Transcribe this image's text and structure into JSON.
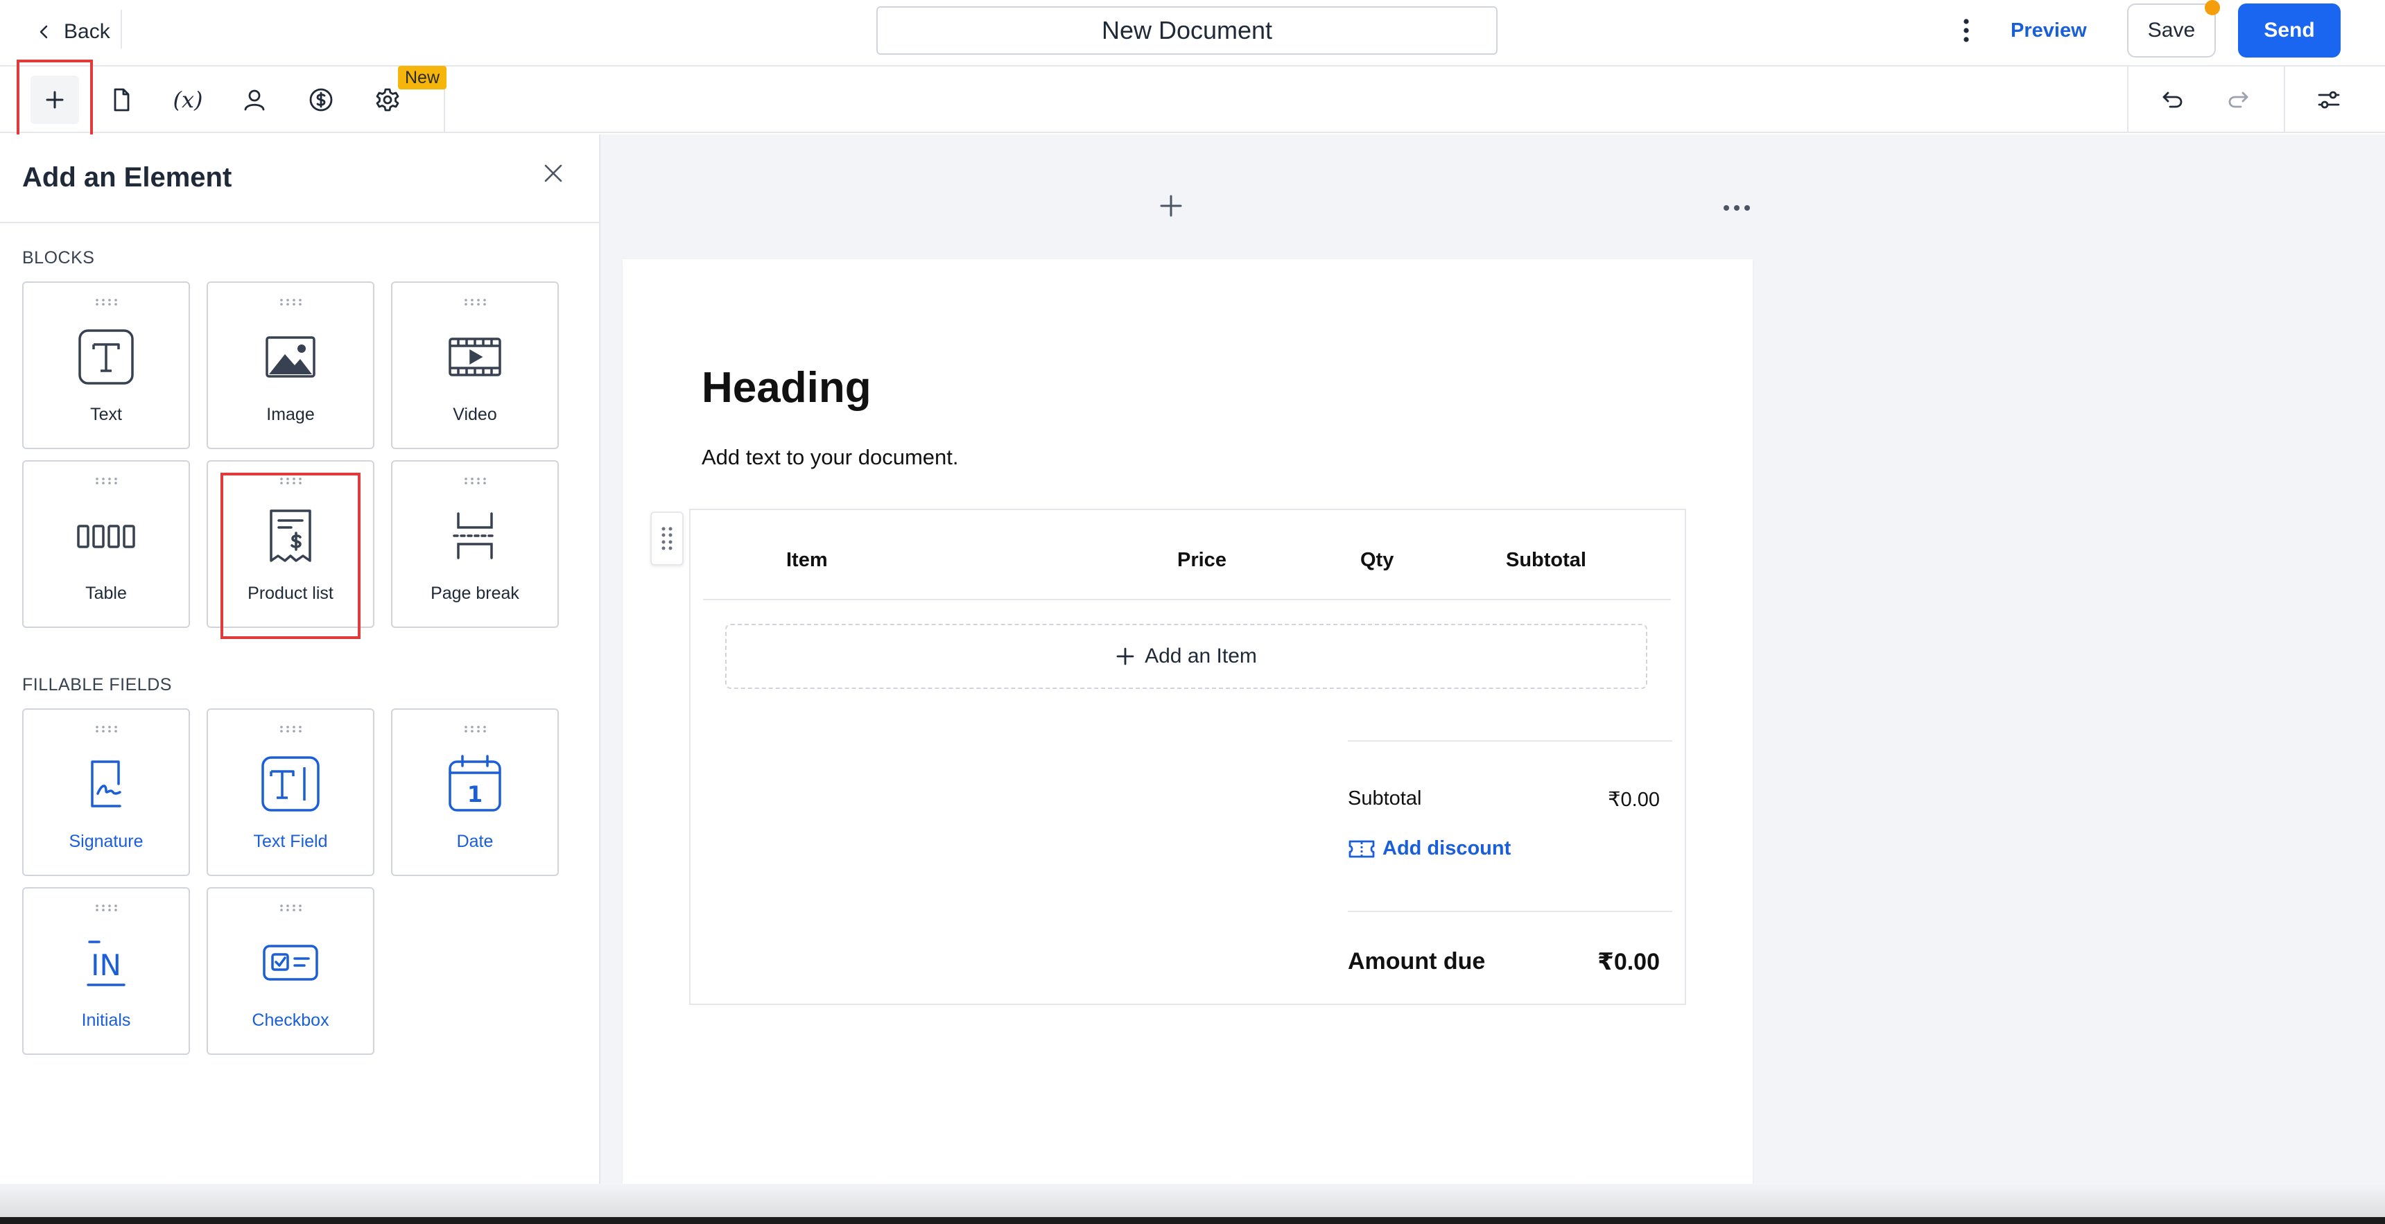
{
  "header": {
    "back_label": "Back",
    "document_title": "New Document",
    "preview_label": "Preview",
    "save_label": "Save",
    "send_label": "Send"
  },
  "toolbar": {
    "tools": [
      "plus-icon",
      "document-icon",
      "variable-icon",
      "user-icon",
      "dollar-icon",
      "gear-icon"
    ],
    "variable_glyph": "(x)",
    "new_badge": "New",
    "right_tools": [
      "undo-icon",
      "redo-icon",
      "settings-sliders-icon"
    ]
  },
  "panel": {
    "title": "Add an Element",
    "blocks_label": "BLOCKS",
    "blocks": [
      {
        "label": "Text",
        "icon": "text-icon"
      },
      {
        "label": "Image",
        "icon": "image-icon"
      },
      {
        "label": "Video",
        "icon": "video-icon"
      },
      {
        "label": "Table",
        "icon": "table-icon"
      },
      {
        "label": "Product list",
        "icon": "product-list-icon"
      },
      {
        "label": "Page break",
        "icon": "page-break-icon"
      }
    ],
    "fields_label": "FILLABLE FIELDS",
    "fields": [
      {
        "label": "Signature",
        "icon": "signature-icon"
      },
      {
        "label": "Text Field",
        "icon": "text-field-icon"
      },
      {
        "label": "Date",
        "icon": "date-icon"
      },
      {
        "label": "Initials",
        "icon": "initials-icon"
      },
      {
        "label": "Checkbox",
        "icon": "checkbox-icon"
      }
    ],
    "date_glyph": "1",
    "initials_glyph": "IN"
  },
  "document": {
    "heading": "Heading",
    "body_text": "Add text to your document.",
    "product_list": {
      "columns": [
        "Item",
        "Price",
        "Qty",
        "Subtotal"
      ],
      "add_item_label": "Add an Item",
      "subtotal_label": "Subtotal",
      "subtotal_value": "₹0.00",
      "add_discount_label": "Add discount",
      "amount_due_label": "Amount due",
      "amount_due_value": "₹0.00"
    }
  },
  "colors": {
    "accent": "#1a66f0",
    "link": "#1a5fd9",
    "badge": "#f5b50a",
    "highlight": "#e03a3a",
    "notification_dot": "#f59e0b"
  }
}
